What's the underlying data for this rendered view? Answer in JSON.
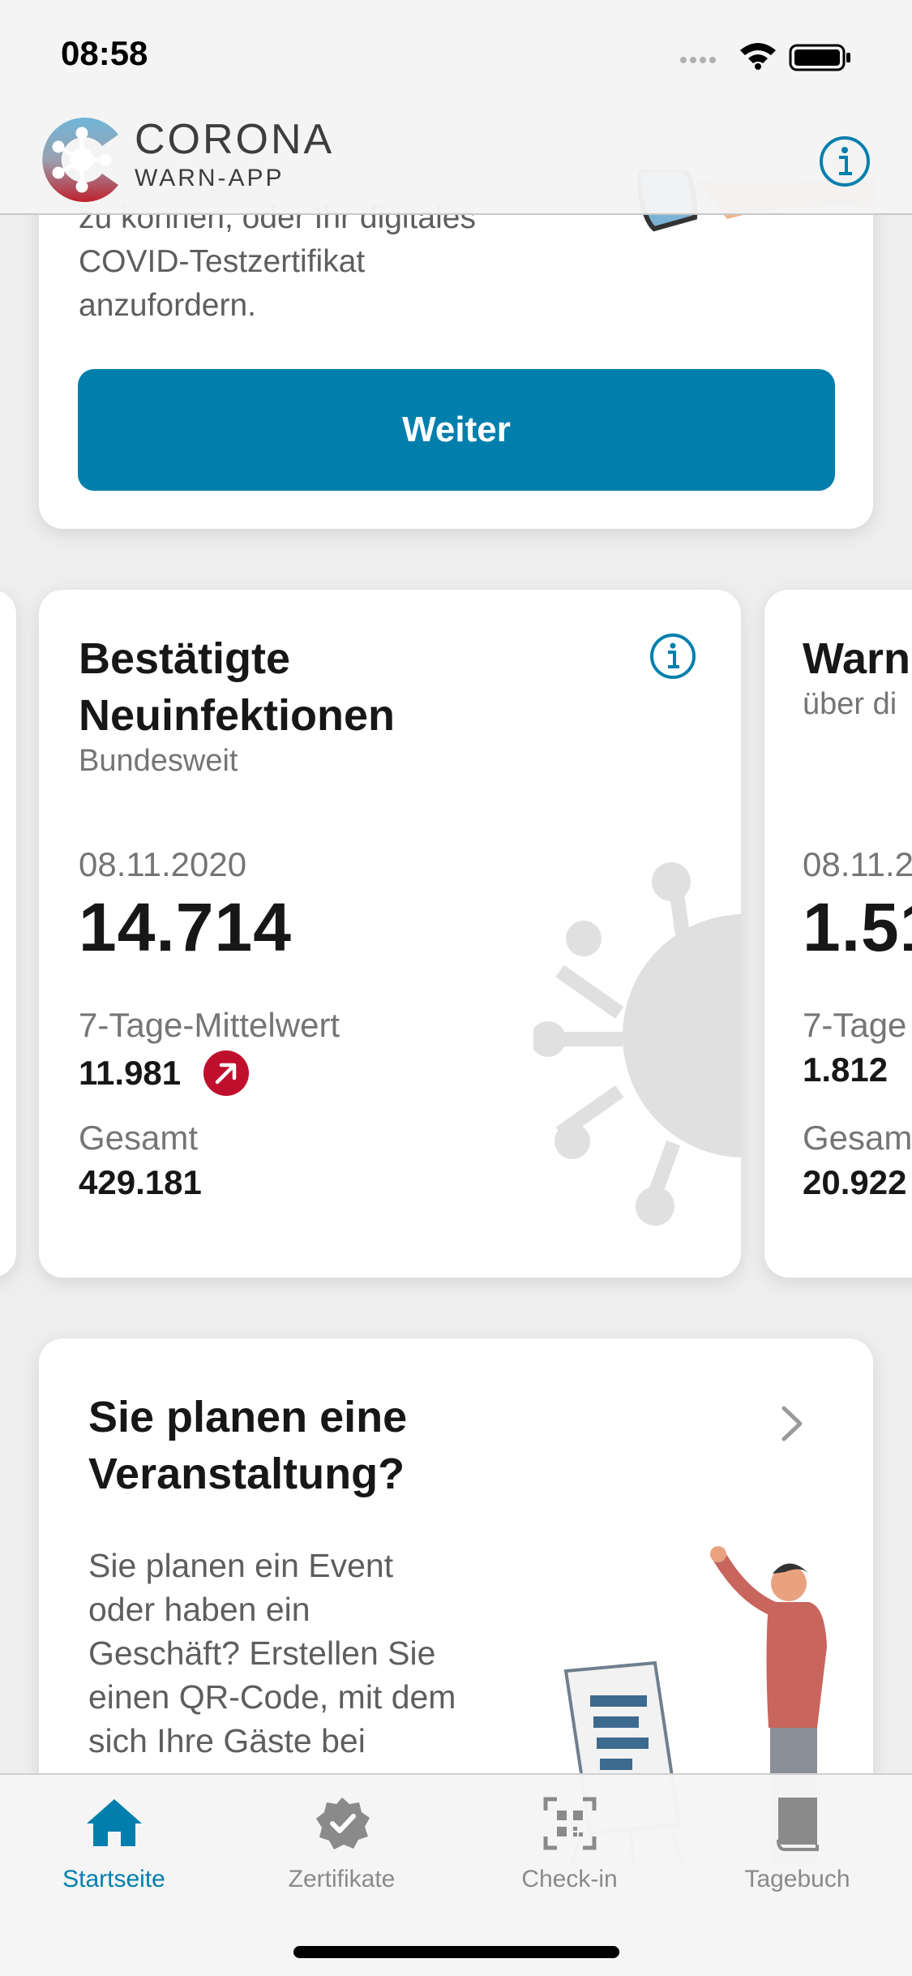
{
  "status_bar": {
    "time": "08:58"
  },
  "header": {
    "logo_line1": "CORONA",
    "logo_line2": "WARN-APP",
    "info_icon": "info-icon"
  },
  "top_card": {
    "body_lines": [
      "zu können, oder Ihr digitales",
      "COVID-Testzertifikat",
      "anzufordern."
    ],
    "button_label": "Weiter"
  },
  "stats_card": {
    "title_lines": [
      "Bestätigte",
      "Neuinfektionen"
    ],
    "subtitle": "Bundesweit",
    "date": "08.11.2020",
    "value": "14.714",
    "avg_label": "7-Tage-Mittelwert",
    "avg_value": "11.981",
    "trend": "up",
    "total_label": "Gesamt",
    "total_value": "429.181"
  },
  "stats_card_2": {
    "title": "Warn",
    "subtitle": "über di",
    "date": "08.11.2",
    "value": "1.51",
    "avg_label": "7-Tage",
    "avg_value": "1.812",
    "total_label": "Gesam",
    "total_value": "20.922"
  },
  "event_card": {
    "title_lines": [
      "Sie planen eine",
      "Veranstaltung?"
    ],
    "body_lines": [
      "Sie planen ein Event",
      "oder haben ein",
      "Geschäft? Erstellen Sie",
      "einen QR-Code, mit dem",
      "sich Ihre Gäste bei"
    ]
  },
  "tabbar": {
    "tabs": [
      {
        "label": "Startseite",
        "icon": "home-icon",
        "active": true
      },
      {
        "label": "Zertifikate",
        "icon": "certificate-icon",
        "active": false
      },
      {
        "label": "Check-in",
        "icon": "qr-scan-icon",
        "active": false
      },
      {
        "label": "Tagebuch",
        "icon": "book-icon",
        "active": false
      }
    ]
  },
  "colors": {
    "accent": "#007fad",
    "trend_up": "#c00f2d",
    "background": "#eeeeee"
  }
}
